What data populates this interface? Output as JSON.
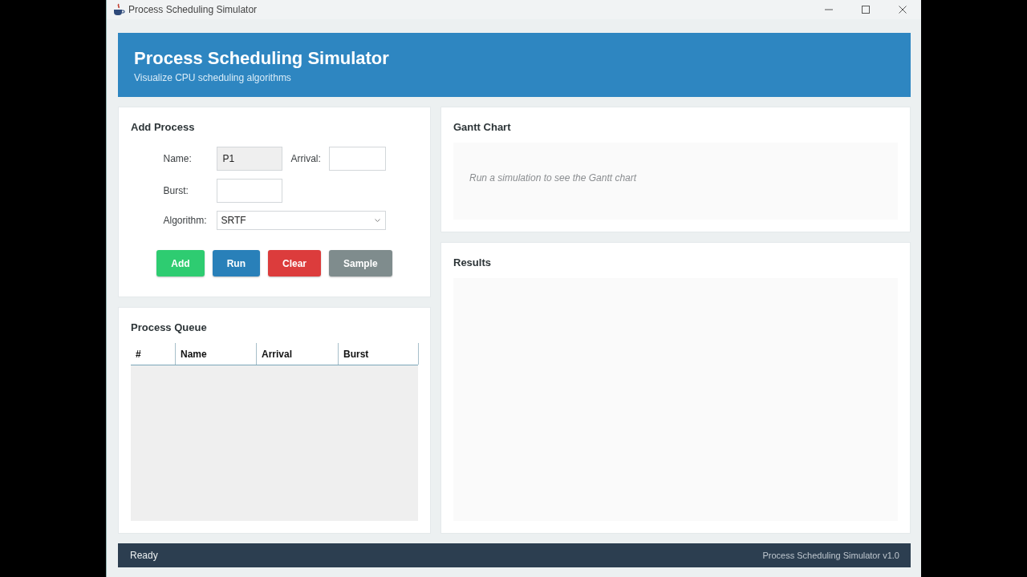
{
  "window": {
    "title": "Process Scheduling Simulator"
  },
  "header": {
    "title": "Process Scheduling Simulator",
    "subtitle": "Visualize CPU scheduling algorithms"
  },
  "add_process": {
    "title": "Add Process",
    "fields": [
      {
        "label": "Name:",
        "value": "P1",
        "editable": false
      },
      {
        "label": "Arrival:",
        "editable": true
      },
      {
        "label": "Burst:",
        "editable": true
      }
    ],
    "algorithm": {
      "label": "Algorithm:",
      "value": "SRTF"
    },
    "buttons": [
      {
        "label": "Add",
        "color": "#2ecc71"
      },
      {
        "label": "Run",
        "color": "#2980b9"
      },
      {
        "label": "Clear",
        "color": "#dc3c3c"
      },
      {
        "label": "Sample",
        "color": "#7f8c8d"
      }
    ]
  },
  "process_queue": {
    "title": "Process Queue",
    "columns": [
      "#",
      "Name",
      "Arrival",
      "Burst"
    ]
  },
  "gantt_chart": {
    "title": "Gantt Chart",
    "empty_message": "Run a simulation to see the Gantt chart"
  },
  "results": {
    "title": "Results"
  },
  "status_bar": {
    "status": "Ready",
    "version": "Process Scheduling Simulator v1.0"
  }
}
